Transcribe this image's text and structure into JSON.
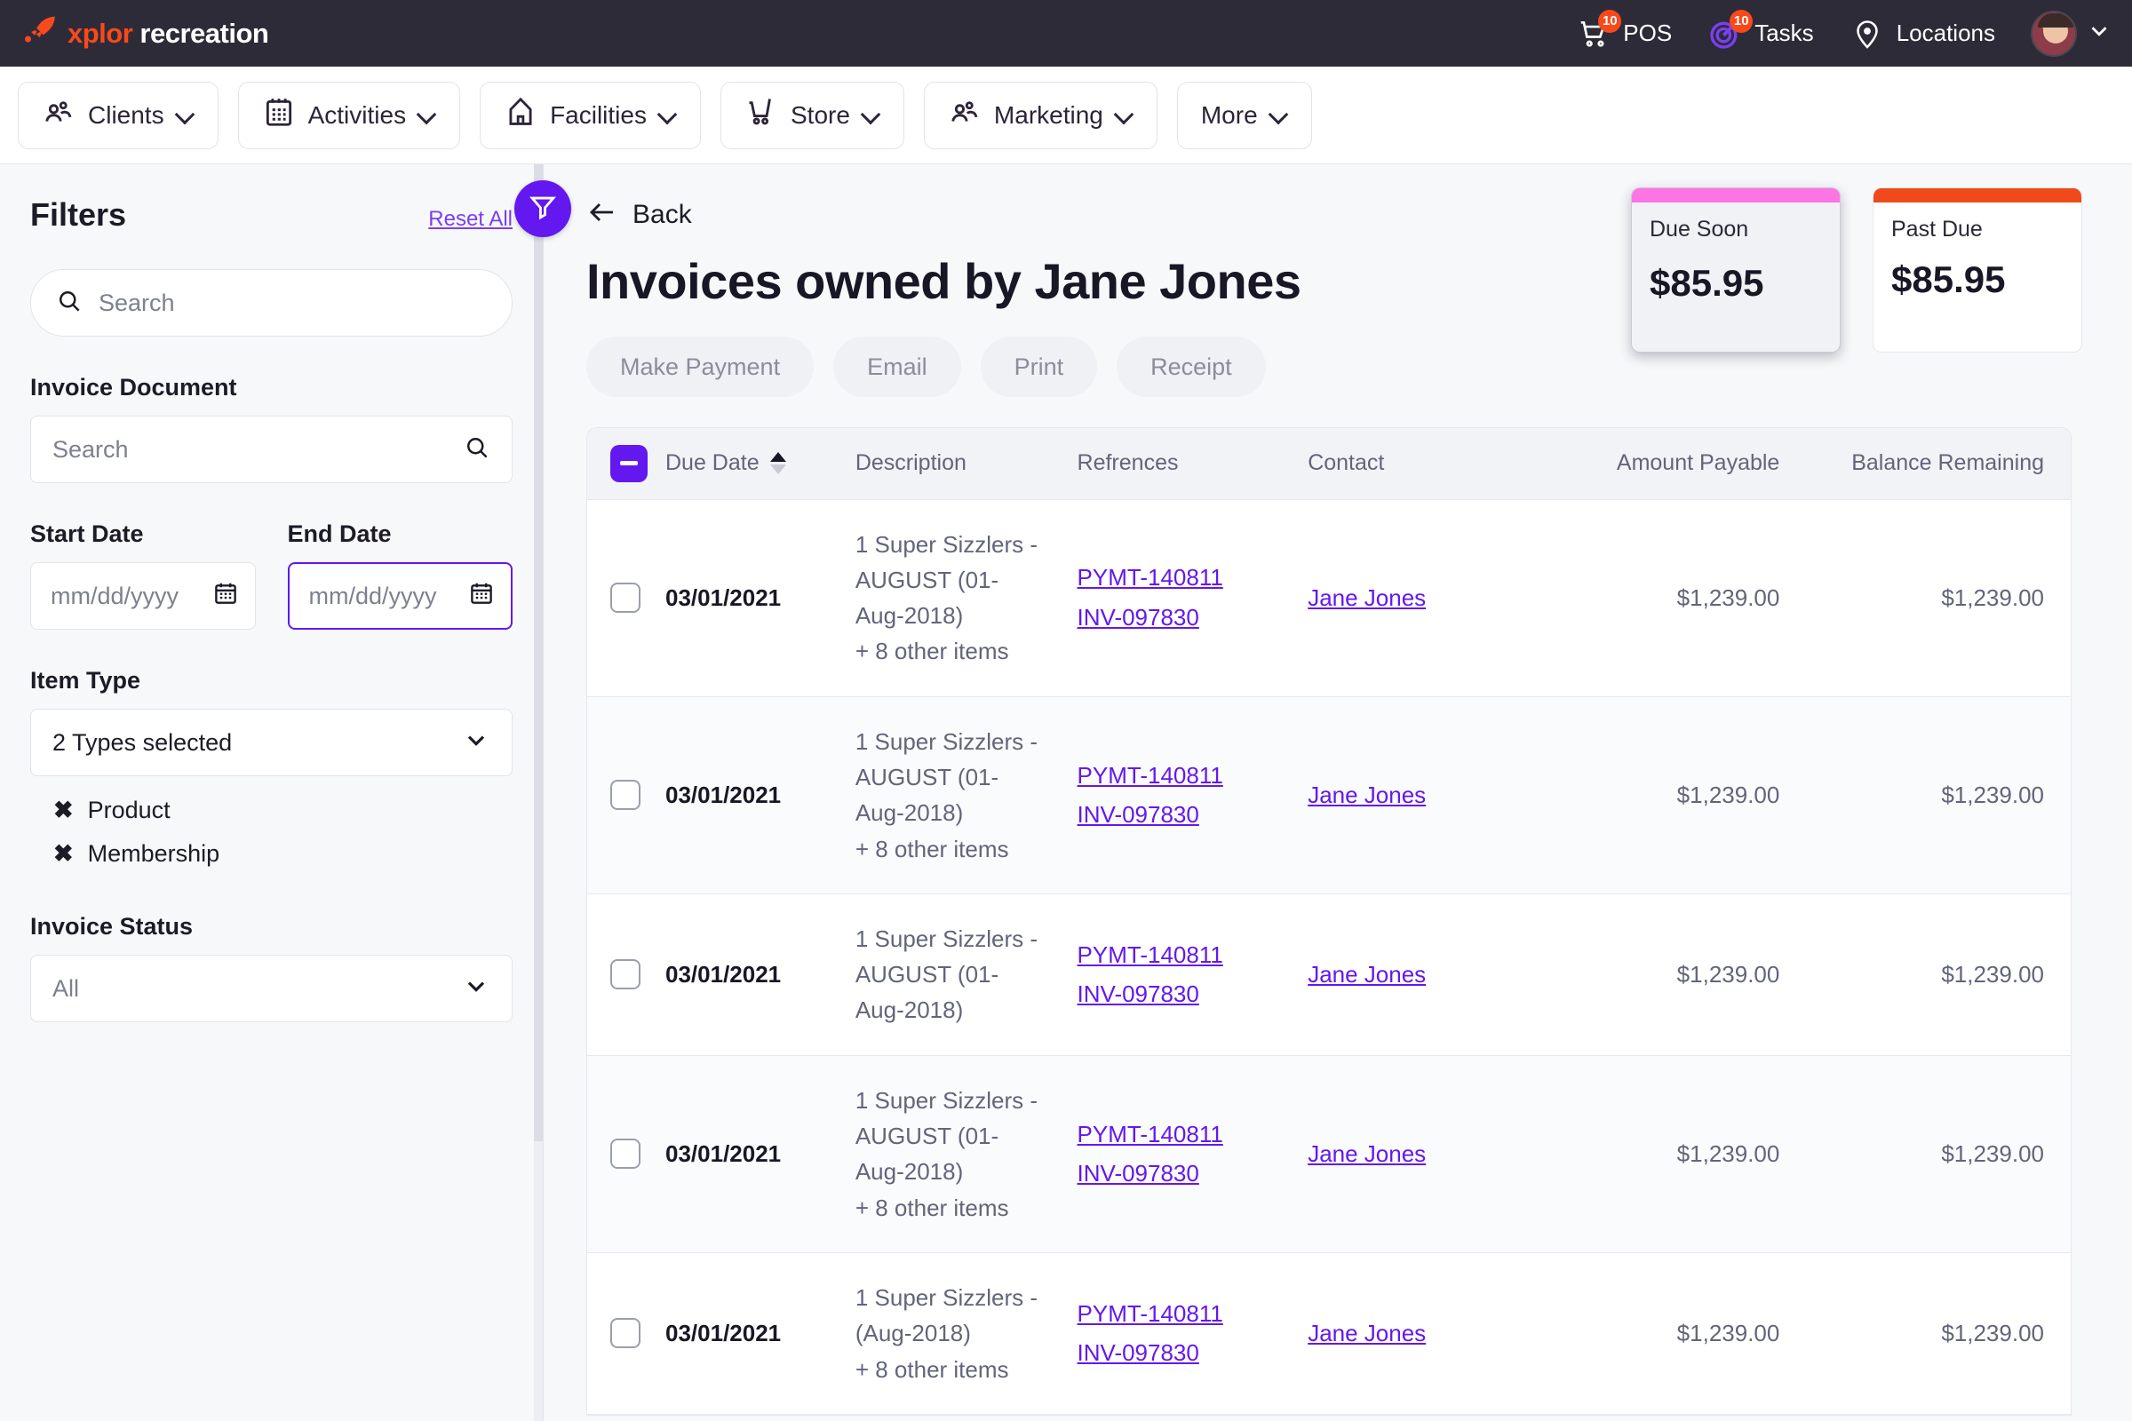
{
  "brand": {
    "name_orange": "xplor",
    "name_white": "recreation",
    "logo_icon": "rocket-icon"
  },
  "topnav": [
    {
      "label": "POS",
      "icon": "shopping-cart-icon",
      "badge": "10"
    },
    {
      "label": "Tasks",
      "icon": "target-icon",
      "badge": "10"
    },
    {
      "label": "Locations",
      "icon": "location-pin-icon",
      "badge": ""
    }
  ],
  "menubar": [
    {
      "label": "Clients",
      "icon": "people-icon"
    },
    {
      "label": "Activities",
      "icon": "calendar-icon"
    },
    {
      "label": "Facilities",
      "icon": "building-icon"
    },
    {
      "label": "Store",
      "icon": "cart-icon"
    },
    {
      "label": "Marketing",
      "icon": "people-icon"
    },
    {
      "label": "More",
      "icon": ""
    }
  ],
  "sidebar": {
    "title": "Filters",
    "reset_label": "Reset All",
    "search_placeholder": "Search",
    "invoice_document_label": "Invoice Document",
    "invoice_document_placeholder": "Search",
    "start_date_label": "Start Date",
    "start_date_value": "mm/dd/yyyy",
    "end_date_label": "End Date",
    "end_date_value": "mm/dd/yyyy",
    "item_type_label": "Item Type",
    "item_type_value": "2 Types selected",
    "item_type_chips": [
      "Product",
      "Membership"
    ],
    "invoice_status_label": "Invoice Status",
    "invoice_status_value": "All"
  },
  "main": {
    "back_label": "Back",
    "page_title": "Invoices owned by Jane Jones",
    "actions": [
      "Make Payment",
      "Email",
      "Print",
      "Receipt"
    ],
    "cards": [
      {
        "label": "Due Soon",
        "value": "$85.95",
        "bar_color": "#fd74e4",
        "hovered": true
      },
      {
        "label": "Past Due",
        "value": "$85.95",
        "bar_color": "#f04a1c",
        "hovered": false
      }
    ]
  },
  "table": {
    "columns": [
      "Due Date",
      "Description",
      "Refrences",
      "Contact",
      "Amount Payable",
      "Balance Remaining"
    ],
    "sort_column": "Due Date",
    "sort_direction": "asc",
    "header_checkbox_state": "indeterminate",
    "rows": [
      {
        "due_date": "03/01/2021",
        "description": [
          "1 Super Sizzlers -",
          "AUGUST (01-",
          "Aug-2018)",
          "+ 8 other items"
        ],
        "references": [
          "PYMT-140811",
          "INV-097830"
        ],
        "contact": "Jane Jones",
        "amount_payable": "$1,239.00",
        "balance_remaining": "$1,239.00"
      },
      {
        "due_date": "03/01/2021",
        "description": [
          "1 Super Sizzlers -",
          "AUGUST (01-",
          "Aug-2018)",
          "+ 8 other items"
        ],
        "references": [
          "PYMT-140811",
          "INV-097830"
        ],
        "contact": "Jane Jones",
        "amount_payable": "$1,239.00",
        "balance_remaining": "$1,239.00"
      },
      {
        "due_date": "03/01/2021",
        "description": [
          "1 Super Sizzlers -",
          "AUGUST (01-",
          "Aug-2018)"
        ],
        "references": [
          "PYMT-140811",
          "INV-097830"
        ],
        "contact": "Jane Jones",
        "amount_payable": "$1,239.00",
        "balance_remaining": "$1,239.00"
      },
      {
        "due_date": "03/01/2021",
        "description": [
          "1 Super Sizzlers -",
          "AUGUST (01-",
          "Aug-2018)",
          "+ 8 other items"
        ],
        "references": [
          "PYMT-140811",
          "INV-097830"
        ],
        "contact": "Jane Jones",
        "amount_payable": "$1,239.00",
        "balance_remaining": "$1,239.00"
      },
      {
        "due_date": "03/01/2021",
        "description": [
          "1 Super Sizzlers -",
          "(Aug-2018)",
          "+ 8 other items"
        ],
        "references": [
          "PYMT-140811",
          "INV-097830"
        ],
        "contact": "Jane Jones",
        "amount_payable": "$1,239.00",
        "balance_remaining": "$1,239.00"
      }
    ]
  },
  "colors": {
    "brand_orange": "#f8491c",
    "accent_purple": "#6318ef",
    "topbar_bg": "#2e2b38",
    "due_soon_pink": "#fd74e4",
    "past_due_orange": "#f04a1c"
  }
}
